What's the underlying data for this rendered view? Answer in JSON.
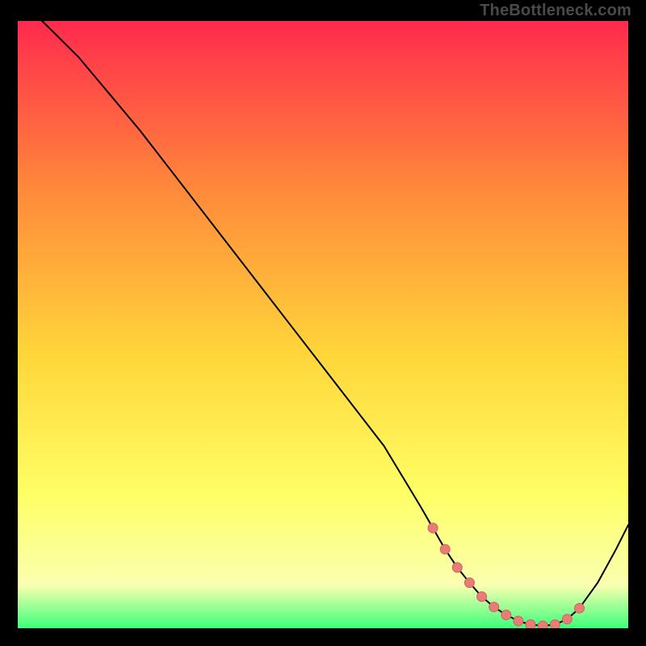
{
  "watermark": "TheBottleneck.com",
  "colors": {
    "frame_bg": "#000000",
    "gradient_top": "#ff2a4d",
    "gradient_mid1": "#ff8a3a",
    "gradient_mid2": "#ffd63a",
    "gradient_mid3": "#ffff66",
    "gradient_bottom_yellow": "#f9ffb0",
    "gradient_bottom_green": "#3bff7a",
    "curve_color": "#000000",
    "marker_fill": "#e77d78",
    "marker_stroke": "#d85f59"
  },
  "chart_data": {
    "type": "line",
    "title": "",
    "xlabel": "",
    "ylabel": "",
    "xlim": [
      0,
      100
    ],
    "ylim": [
      0,
      100
    ],
    "grid": false,
    "series": [
      {
        "name": "bottleneck-curve",
        "x": [
          4,
          6,
          10,
          15,
          20,
          25,
          30,
          35,
          40,
          45,
          50,
          55,
          60,
          63,
          66,
          68,
          70,
          72,
          74,
          76,
          78,
          80,
          82,
          84,
          86,
          88,
          90,
          92,
          95,
          98,
          100
        ],
        "y": [
          100,
          98,
          94,
          88,
          82,
          75.5,
          69,
          62.5,
          56,
          49.5,
          43,
          36.5,
          30,
          25,
          20,
          16.5,
          13,
          10,
          7.5,
          5.2,
          3.5,
          2.2,
          1.2,
          0.6,
          0.4,
          0.6,
          1.5,
          3.3,
          7.5,
          13,
          17
        ]
      }
    ],
    "markers": {
      "name": "highlight-points",
      "x": [
        68,
        70,
        72,
        74,
        76,
        78,
        80,
        82,
        84,
        86,
        88,
        90,
        92
      ],
      "y": [
        16.5,
        13,
        10,
        7.5,
        5.2,
        3.5,
        2.2,
        1.2,
        0.6,
        0.4,
        0.6,
        1.5,
        3.3
      ]
    }
  }
}
